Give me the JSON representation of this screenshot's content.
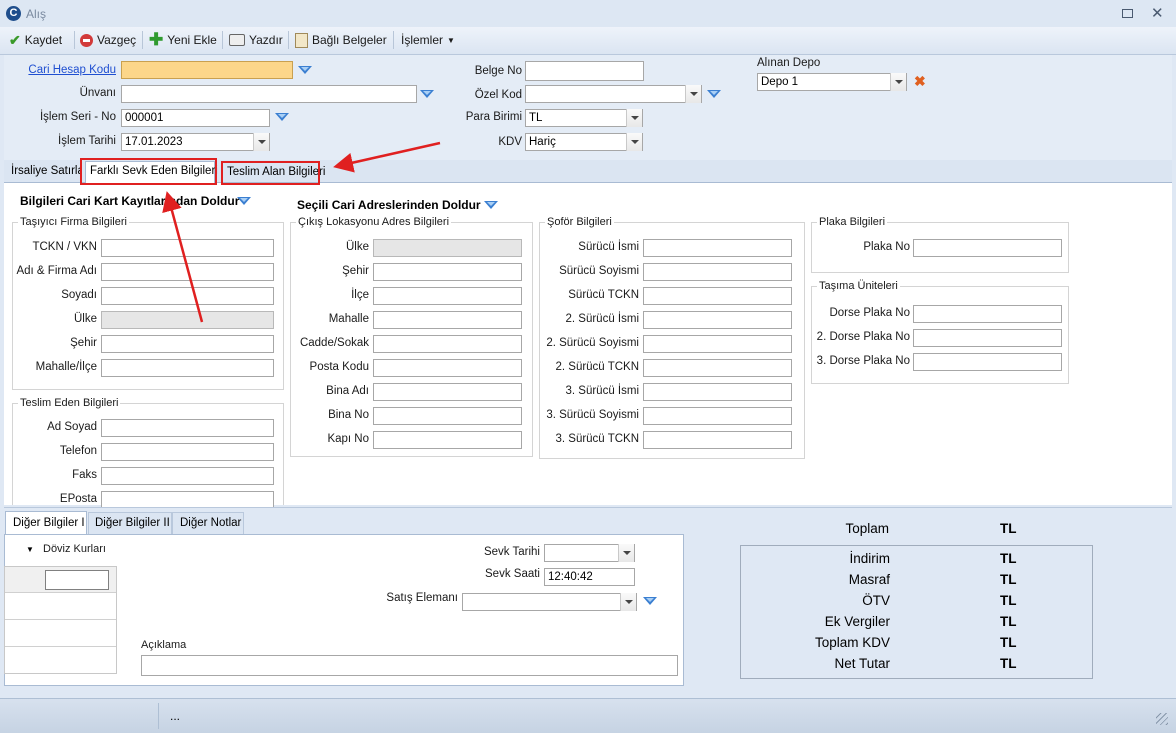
{
  "window": {
    "title": "Alış"
  },
  "toolbar": {
    "save": "Kaydet",
    "cancel": "Vazgeç",
    "new": "Yeni Ekle",
    "print": "Yazdır",
    "linked_docs": "Bağlı Belgeler",
    "operations": "İşlemler"
  },
  "header": {
    "cari_hesap_kodu_label": "Cari Hesap Kodu",
    "cari_hesap_kodu_value": "",
    "unvani_label": "Ünvanı",
    "unvani_value": "",
    "islem_seri_no_label": "İşlem  Seri - No",
    "islem_seri_no_value": "000001",
    "islem_tarihi_label": "İşlem Tarihi",
    "islem_tarihi_value": "17.01.2023",
    "belge_no_label": "Belge No",
    "belge_no_value": "",
    "ozel_kod_label": "Özel Kod",
    "ozel_kod_value": "",
    "para_birimi_label": "Para Birimi",
    "para_birimi_value": "TL",
    "kdv_label": "KDV",
    "kdv_value": "Hariç",
    "alinan_depo_label": "Alınan Depo",
    "alinan_depo_value": "Depo 1"
  },
  "tabs": [
    "İrsaliye Satırları",
    "Farklı Sevk Eden Bilgileri",
    "Teslim Alan Bilgileri"
  ],
  "sevk": {
    "fill_from_card": "Bilgileri Cari Kart Kayıtlarından Doldur",
    "fill_from_address": "Seçili Cari Adreslerinden Doldur",
    "tasiyici": {
      "title": "Taşıyıcı Firma Bilgileri",
      "fields": [
        "TCKN / VKN",
        "Adı & Firma Adı",
        "Soyadı",
        "Ülke",
        "Şehir",
        "Mahalle/İlçe"
      ]
    },
    "teslim_eden": {
      "title": "Teslim Eden Bilgileri",
      "fields": [
        "Ad Soyad",
        "Telefon",
        "Faks",
        "EPosta"
      ]
    },
    "cikis": {
      "title": "Çıkış Lokasyonu Adres Bilgileri",
      "fields": [
        "Ülke",
        "Şehir",
        "İlçe",
        "Mahalle",
        "Cadde/Sokak",
        "Posta Kodu",
        "Bina Adı",
        "Bina No",
        "Kapı No"
      ]
    },
    "sofor": {
      "title": "Şoför Bilgileri",
      "fields": [
        "Sürücü İsmi",
        "Sürücü Soyismi",
        "Sürücü TCKN",
        "2. Sürücü İsmi",
        "2. Sürücü Soyismi",
        "2. Sürücü TCKN",
        "3. Sürücü İsmi",
        "3. Sürücü Soyismi",
        "3. Sürücü TCKN"
      ]
    },
    "plaka": {
      "title": "Plaka Bilgileri",
      "fields": [
        "Plaka No"
      ]
    },
    "tasima": {
      "title": "Taşıma Üniteleri",
      "fields": [
        "Dorse Plaka No",
        "2. Dorse Plaka No",
        "3. Dorse Plaka No"
      ]
    }
  },
  "bottom_tabs": [
    "Diğer Bilgiler I",
    "Diğer Bilgiler II",
    "Diğer Notlar"
  ],
  "other": {
    "doviz_kurlari": "Döviz Kurları",
    "sevk_tarihi_label": "Sevk Tarihi",
    "sevk_tarihi_value": "",
    "sevk_saati_label": "Sevk Saati",
    "sevk_saati_value": "12:40:42",
    "satis_elemani_label": "Satış Elemanı",
    "satis_elemani_value": "",
    "aciklama_label": "Açıklama",
    "aciklama_value": ""
  },
  "totals": {
    "toplam_label": "Toplam",
    "currency": "TL",
    "rows": [
      "İndirim",
      "Masraf",
      "ÖTV",
      "Ek Vergiler",
      "Toplam KDV",
      "Net Tutar"
    ]
  },
  "statusbar": {
    "text": "..."
  },
  "colors": {
    "annotation": "#e02020",
    "accent": "#3b7fd1"
  }
}
